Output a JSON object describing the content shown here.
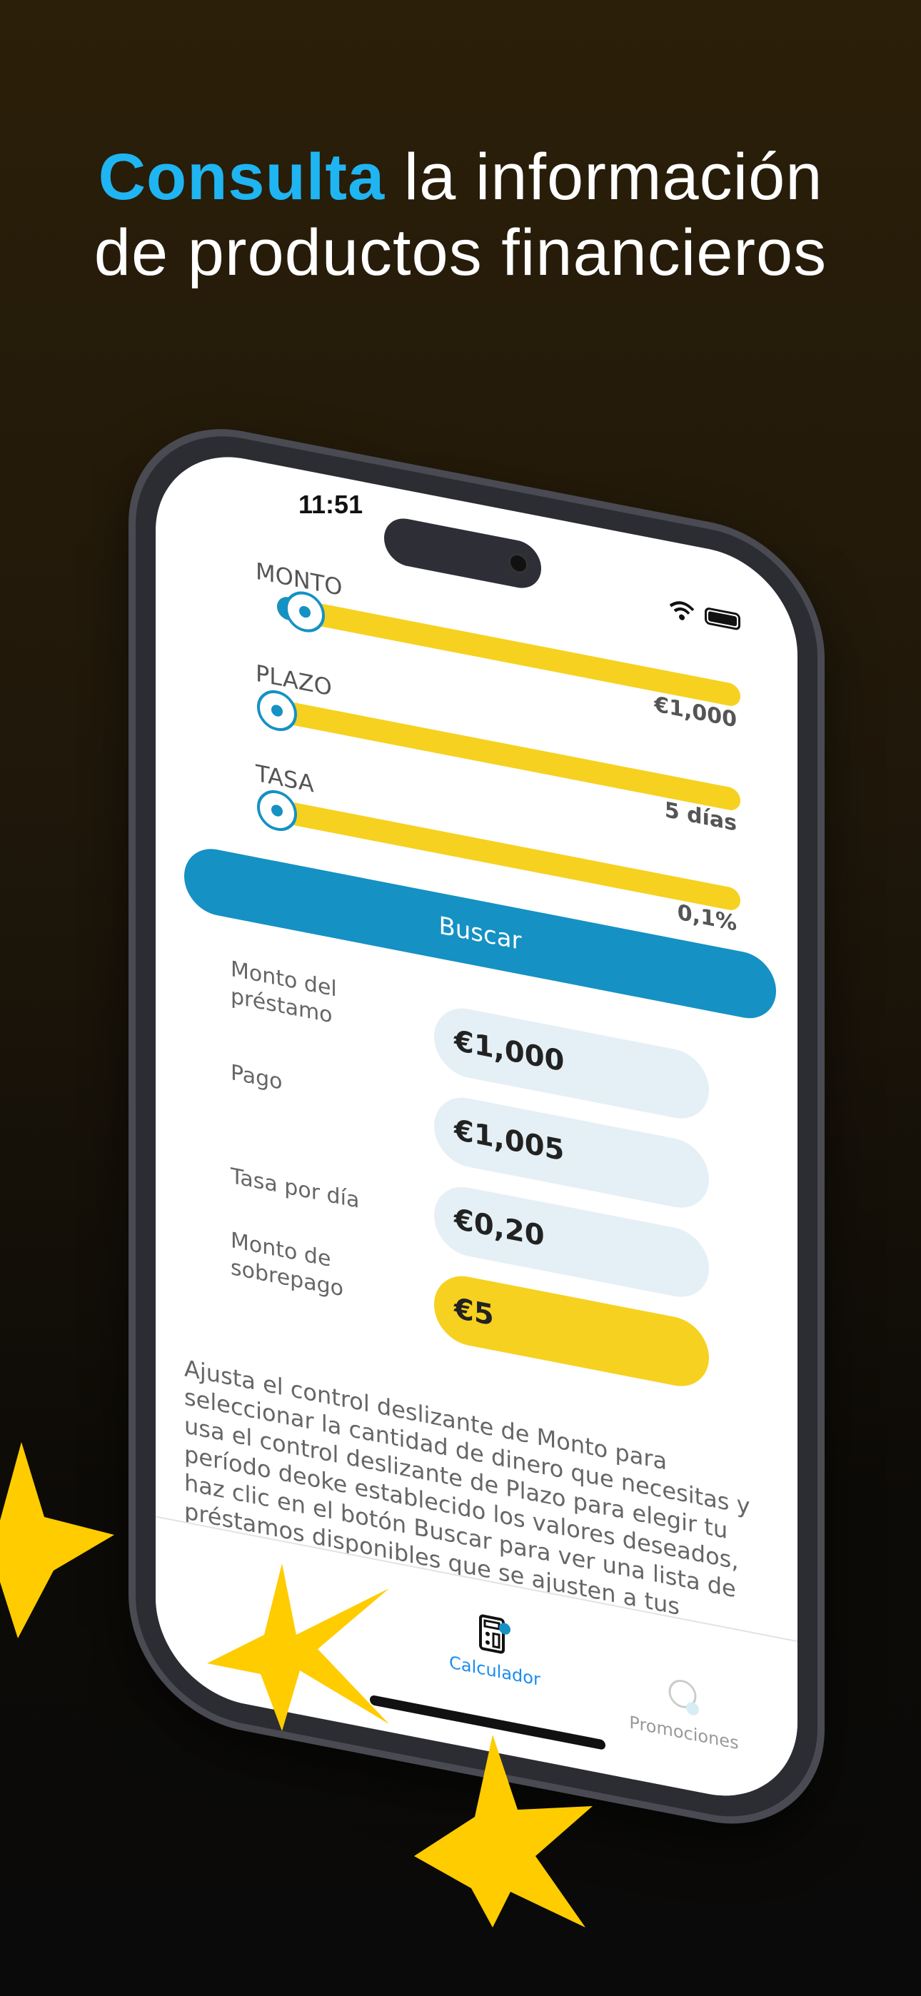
{
  "headline": {
    "highlight": "Consulta",
    "line1_rest": " la información",
    "line2": "de productos financieros"
  },
  "status_bar": {
    "time": "11:51"
  },
  "sliders": [
    {
      "label": "MONTO",
      "value": "€1,000",
      "fill_fraction": 0.06
    },
    {
      "label": "PLAZO",
      "value": "5 días",
      "fill_fraction": 0
    },
    {
      "label": "TASA",
      "value": "0,1%",
      "fill_fraction": 0
    }
  ],
  "search_button": "Buscar",
  "results": [
    {
      "label": "Monto del préstamo",
      "value": "€1,000"
    },
    {
      "label": "Pago",
      "value": "€1,005"
    },
    {
      "label": "Tasa por día",
      "value": "€0,20"
    },
    {
      "label": "Monto de sobrepago",
      "value": "€5"
    }
  ],
  "instructions": "Ajusta el control deslizante de Monto para seleccionar la cantidad de dinero que necesitas y usa el control deslizante de Plazo para elegir tu período deoke establecido los valores deseados, haz clic en el botón Buscar para ver una lista de préstamos disponibles que se ajusten a tus",
  "tabs": [
    {
      "label": "Calculador",
      "icon": "calculator-icon",
      "active": true
    },
    {
      "label": "Promociones",
      "icon": "promotions-icon",
      "active": false
    }
  ],
  "colors": {
    "accent": "#1591c4",
    "highlight": "#1fb5f2",
    "yellow": "#f6d120",
    "star": "#ffcc00"
  }
}
